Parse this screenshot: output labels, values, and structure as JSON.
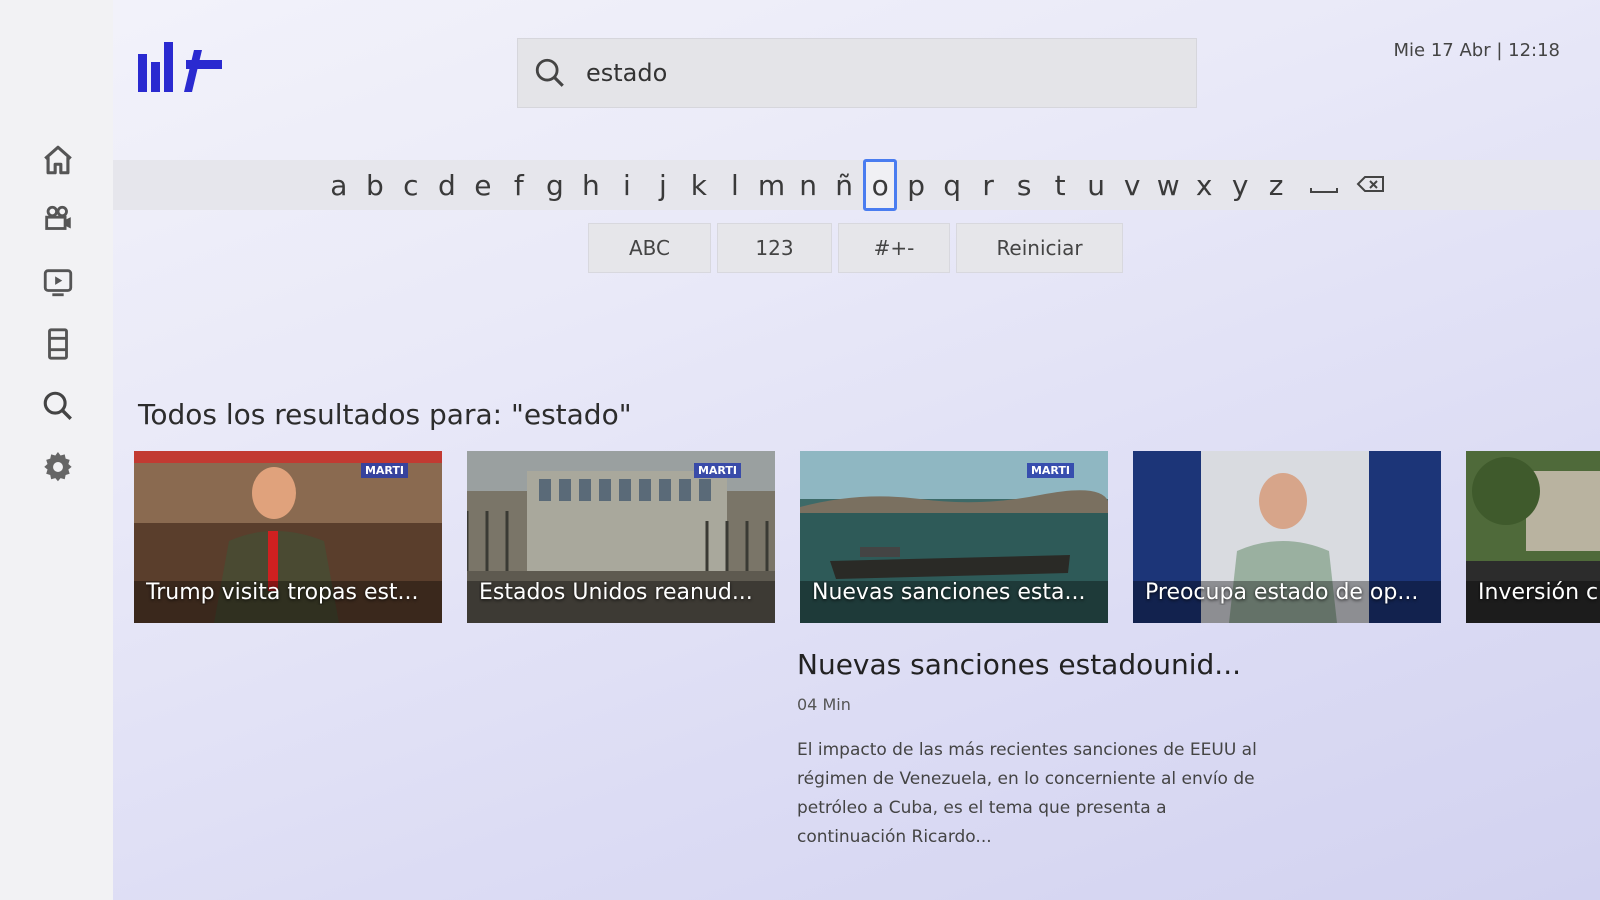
{
  "app": {
    "logo": "M+"
  },
  "search": {
    "value": "estado",
    "icon": "search-icon"
  },
  "datetime": "Mie 17 Abr  |  12:18",
  "sidebar": {
    "items": [
      {
        "name": "home",
        "icon": "home-icon"
      },
      {
        "name": "shows",
        "icon": "video-camera-icon"
      },
      {
        "name": "live",
        "icon": "tv-icon"
      },
      {
        "name": "movies",
        "icon": "film-icon"
      },
      {
        "name": "search",
        "icon": "search-icon"
      },
      {
        "name": "settings",
        "icon": "gear-icon"
      }
    ]
  },
  "keyboard": {
    "keys": [
      "a",
      "b",
      "c",
      "d",
      "e",
      "f",
      "g",
      "h",
      "i",
      "j",
      "k",
      "l",
      "m",
      "n",
      "ñ",
      "o",
      "p",
      "q",
      "r",
      "s",
      "t",
      "u",
      "v",
      "w",
      "x",
      "y",
      "z"
    ],
    "selected": "o",
    "space_icon": "space-icon",
    "backspace_icon": "backspace-icon",
    "modes": [
      "ABC",
      "123",
      "#+-",
      "Reiniciar"
    ]
  },
  "results": {
    "title": "Todos los resultados para: \"estado\"",
    "items": [
      {
        "caption": "Trump visita tropas est...",
        "brand": "MARTI"
      },
      {
        "caption": "Estados Unidos reanud...",
        "brand": "MARTI"
      },
      {
        "caption": "Nuevas sanciones esta...",
        "brand": "MARTI"
      },
      {
        "caption": "Preocupa estado de op...",
        "brand": ""
      },
      {
        "caption": "Inversión c",
        "brand": ""
      }
    ]
  },
  "detail": {
    "title": "Nuevas sanciones estadounid...",
    "duration": "04 Min",
    "description": "El impacto de las más recientes sanciones de EEUU al régimen de Venezuela, en lo concerniente al envío de petróleo a Cuba, es el tema que presenta a continuación Ricardo..."
  },
  "colors": {
    "accent": "#4a7df0",
    "logo": "#2a2ad0"
  }
}
